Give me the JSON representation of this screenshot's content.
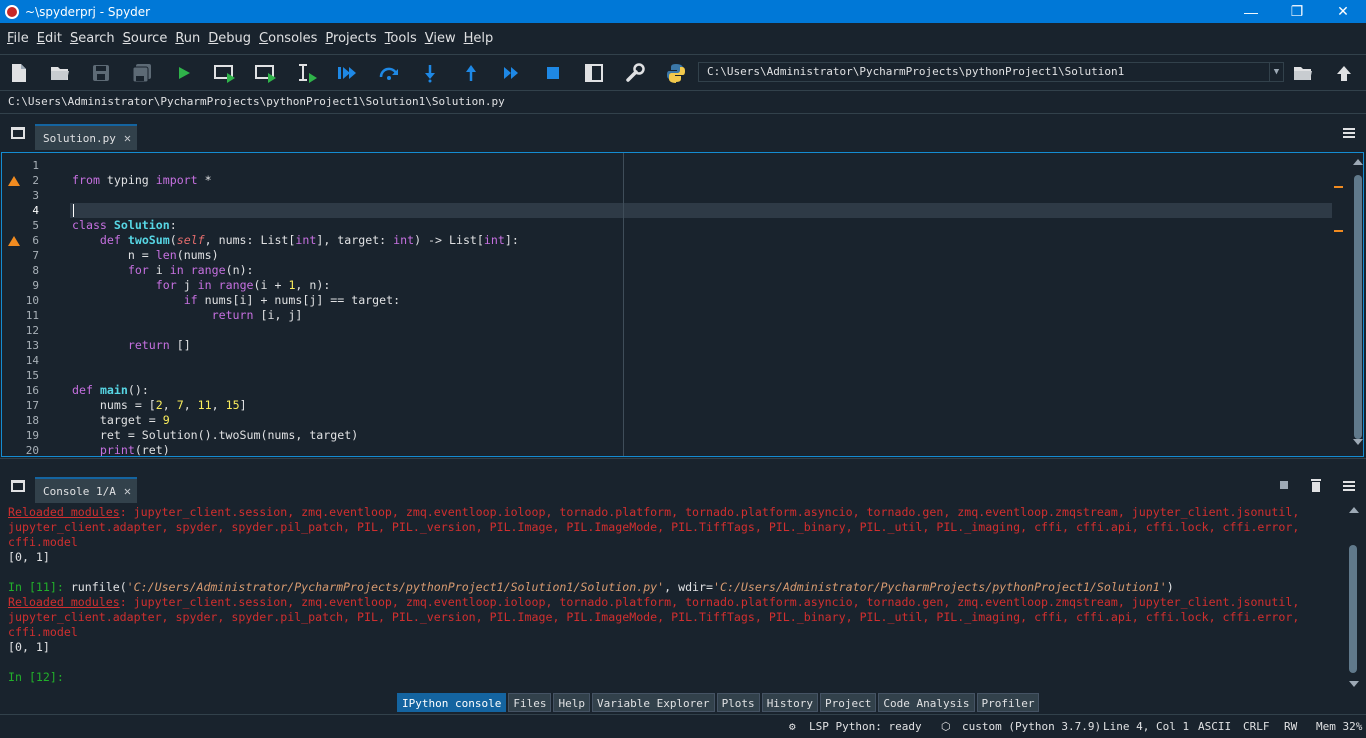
{
  "window": {
    "title": "~\\spyderprj - Spyder",
    "minimize": "—",
    "restore": "❐",
    "close": "✕"
  },
  "menu": [
    "File",
    "Edit",
    "Search",
    "Source",
    "Run",
    "Debug",
    "Consoles",
    "Projects",
    "Tools",
    "View",
    "Help"
  ],
  "toolbar": {
    "working_dir": "C:\\Users\\Administrator\\PycharmProjects\\pythonProject1\\Solution1",
    "icons": [
      "new-file",
      "open-file",
      "save",
      "save-all",
      "run",
      "run-cell",
      "run-cell-advance",
      "run-selection",
      "debug",
      "step",
      "step-into",
      "step-return",
      "continue",
      "stop",
      "maximize-pane",
      "preferences",
      "python-path",
      "browse-folder",
      "parent-dir"
    ]
  },
  "editor": {
    "file_path": "C:\\Users\\Administrator\\PycharmProjects\\pythonProject1\\Solution1\\Solution.py",
    "tab_label": "Solution.py",
    "current_line": 4,
    "warning_lines": [
      2,
      6
    ],
    "line_numbers": [
      "1",
      "2",
      "3",
      "4",
      "5",
      "6",
      "7",
      "8",
      "9",
      "10",
      "11",
      "12",
      "13",
      "14",
      "15",
      "16",
      "17",
      "18",
      "19",
      "20"
    ]
  },
  "console": {
    "tab_label": "Console 1/A",
    "reloaded_label": "Reloaded modules",
    "reloaded_rest_1": ": jupyter_client.session, zmq.eventloop, zmq.eventloop.ioloop, tornado.platform, tornado.platform.asyncio, tornado.gen, zmq.eventloop.zmqstream, jupyter_client.jsonutil,",
    "reloaded_line_2": "jupyter_client.adapter, spyder, spyder.pil_patch, PIL, PIL._version, PIL.Image, PIL.ImageMode, PIL.TiffTags, PIL._binary, PIL._util, PIL._imaging, cffi, cffi.api, cffi.lock, cffi.error,",
    "reloaded_line_3": "cffi.model",
    "output": "[0, 1]",
    "prompt_11": "In [11]: ",
    "runfile_a": "runfile(",
    "runfile_path": "'C:/Users/Administrator/PycharmProjects/pythonProject1/Solution1/Solution.py'",
    "runfile_b": ", wdir=",
    "runfile_wdir": "'C:/Users/Administrator/PycharmProjects/pythonProject1/Solution1'",
    "runfile_c": ")",
    "prompt_12": "In [12]: "
  },
  "bottom_tabs": [
    "IPython console",
    "Files",
    "Help",
    "Variable Explorer",
    "Plots",
    "History",
    "Project",
    "Code Analysis",
    "Profiler"
  ],
  "status": {
    "lsp": "LSP Python: ready",
    "env": "custom (Python 3.7.9)",
    "position": "Line 4, Col 1",
    "encoding": "ASCII",
    "eol": "CRLF",
    "rw": "RW",
    "mem": "Mem 32%"
  },
  "colors": {
    "accent": "#1464a0",
    "background": "#19232d",
    "warning": "#f18b20",
    "error_text": "#d02f2f",
    "prompt": "#21b02a"
  }
}
